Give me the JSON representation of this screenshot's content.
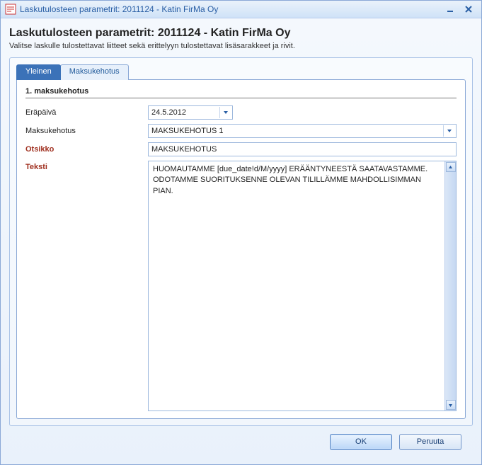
{
  "window": {
    "title": "Laskutulosteen parametrit: 2011124 - Katin FirMa Oy"
  },
  "header": {
    "heading": "Laskutulosteen parametrit: 2011124 - Katin FirMa Oy",
    "subtext": "Valitse laskulle tulostettavat liitteet sekä erittelyyn tulostettavat lisäsarakkeet ja rivit."
  },
  "tabs": {
    "general": "Yleinen",
    "reminder": "Maksukehotus"
  },
  "section": {
    "title": "1. maksukehotus"
  },
  "form": {
    "dueDate": {
      "label": "Eräpäivä",
      "value": "24.5.2012"
    },
    "reminder": {
      "label": "Maksukehotus",
      "value": "MAKSUKEHOTUS 1"
    },
    "title": {
      "label": "Otsikko",
      "value": "MAKSUKEHOTUS"
    },
    "text": {
      "label": "Teksti",
      "value": "HUOMAUTAMME [due_date!d/M/yyyy] ERÄÄNTYNEESTÄ SAATAVASTAMME. ODOTAMME SUORITUKSENNE OLEVAN TILILLÄMME MAHDOLLISIMMAN PIAN."
    }
  },
  "buttons": {
    "ok": "OK",
    "cancel": "Peruuta"
  }
}
